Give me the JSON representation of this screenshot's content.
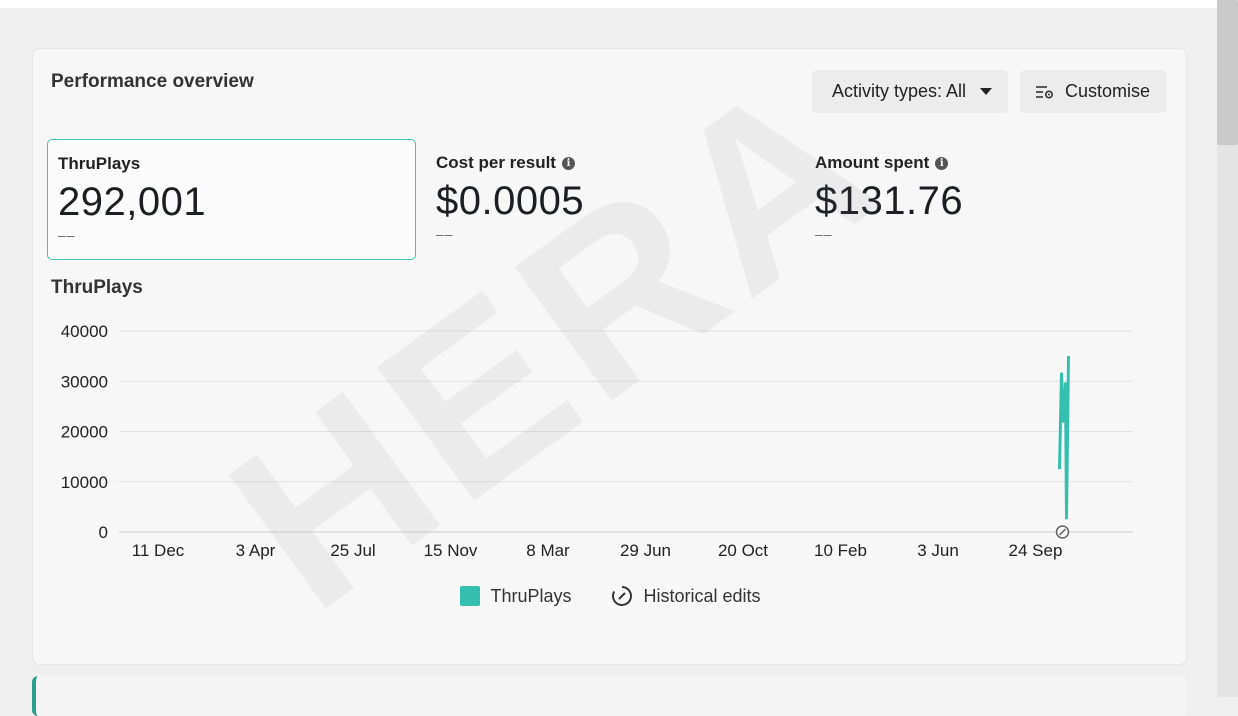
{
  "card": {
    "title": "Performance overview",
    "activity_button": "Activity types: All",
    "customise_button": "Customise"
  },
  "metrics": [
    {
      "label": "ThruPlays",
      "value": "292,001",
      "delta": "––",
      "selected": true
    },
    {
      "label": "Cost per result",
      "value": "$0.0005",
      "delta": "––",
      "info_icon": true
    },
    {
      "label": "Amount spent",
      "value": "$131.76",
      "delta": "––",
      "info_icon": true
    }
  ],
  "chart_title": "ThruPlays",
  "chart_data": {
    "type": "line",
    "title": "ThruPlays",
    "xlabel": "",
    "ylabel": "",
    "ylim": [
      0,
      40000
    ],
    "yticks": [
      0,
      10000,
      20000,
      30000,
      40000
    ],
    "xticks": [
      "11 Dec",
      "3 Apr",
      "25 Jul",
      "15 Nov",
      "8 Mar",
      "29 Jun",
      "20 Oct",
      "10 Feb",
      "3 Jun",
      "24 Sep"
    ],
    "grid": true,
    "legend_position": "bottom",
    "series": [
      {
        "name": "ThruPlays",
        "color": "#34bfae",
        "points": [
          {
            "x": "early Oct",
            "y": 12500
          },
          {
            "x": "early Oct",
            "y": 31500
          },
          {
            "x": "early Oct",
            "y": 22000
          },
          {
            "x": "early Oct",
            "y": 29500
          },
          {
            "x": "early Oct",
            "y": 2800
          },
          {
            "x": "early Oct",
            "y": 35000
          }
        ]
      }
    ]
  },
  "legend": {
    "series_label": "ThruPlays",
    "edits_label": "Historical edits"
  },
  "watermark": "HERA"
}
